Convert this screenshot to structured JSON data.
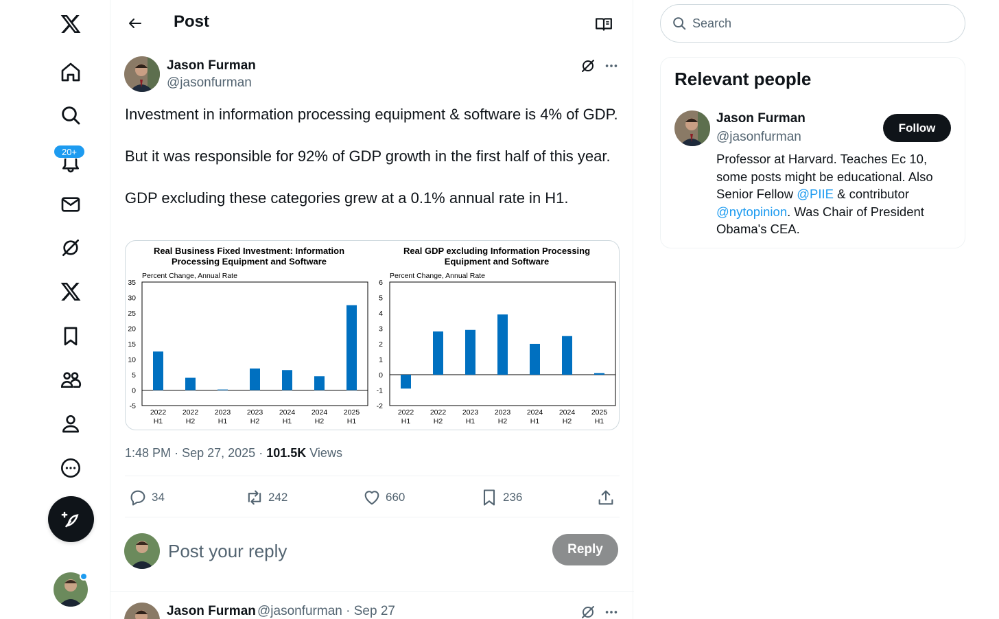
{
  "nav": {
    "notifications_badge": "20+"
  },
  "header": {
    "title": "Post"
  },
  "post": {
    "author_name": "Jason Furman",
    "author_handle": "@jasonfurman",
    "text": [
      "Investment in information processing equipment & software is 4% of GDP.",
      "But it was responsible for 92% of GDP growth in the first half of this year.",
      "GDP excluding these categories grew at a 0.1% annual rate in H1."
    ],
    "time": "1:48 PM",
    "date": "Sep 27, 2025",
    "views_count": "101.5K",
    "views_label": "Views",
    "stats": {
      "replies": "34",
      "reposts": "242",
      "likes": "660",
      "bookmarks": "236"
    }
  },
  "reply": {
    "placeholder": "Post your reply",
    "button_label": "Reply"
  },
  "thread": {
    "author_name": "Jason Furman",
    "meta": "@jasonfurman · Sep 27"
  },
  "search": {
    "placeholder": "Search"
  },
  "relevant_people": {
    "title": "Relevant people",
    "name": "Jason Furman",
    "handle": "@jasonfurman",
    "follow_label": "Follow",
    "bio_1": "Professor at Harvard. Teaches Ec 10, some posts might be educational. Also Senior Fellow ",
    "mention_1": "@PIIE",
    "bio_2": " & contributor ",
    "mention_2": "@nytopinion",
    "bio_3": ". Was Chair of President Obama's CEA."
  },
  "colors": {
    "accent": "#1d9bf0",
    "bar": "#0070c0",
    "text_primary": "#0f1419",
    "text_secondary": "#536471"
  },
  "chart_data": [
    {
      "type": "bar",
      "title": "Real Business Fixed Investment: Information Processing Equipment and Software",
      "ylabel": "Percent Change, Annual Rate",
      "categories": [
        "2022 H1",
        "2022 H2",
        "2023 H1",
        "2023 H2",
        "2024 H1",
        "2024 H2",
        "2025 H1"
      ],
      "cat_top": [
        "2022",
        "2022",
        "2023",
        "2023",
        "2024",
        "2024",
        "2025"
      ],
      "cat_bottom": [
        "H1",
        "H2",
        "H1",
        "H2",
        "H1",
        "H2",
        "H1"
      ],
      "values": [
        12.5,
        4,
        0.2,
        7,
        6.5,
        4.5,
        27.5
      ],
      "ylim": [
        -5,
        35
      ],
      "yticks": [
        -5,
        0,
        5,
        10,
        15,
        20,
        25,
        30,
        35
      ],
      "grid": false
    },
    {
      "type": "bar",
      "title": "Real GDP excluding Information Processing Equipment and Software",
      "ylabel": "Percent Change, Annual Rate",
      "categories": [
        "2022 H1",
        "2022 H2",
        "2023 H1",
        "2023 H2",
        "2024 H1",
        "2024 H2",
        "2025 H1"
      ],
      "cat_top": [
        "2022",
        "2022",
        "2023",
        "2023",
        "2024",
        "2024",
        "2025"
      ],
      "cat_bottom": [
        "H1",
        "H2",
        "H1",
        "H2",
        "H1",
        "H2",
        "H1"
      ],
      "values": [
        -0.9,
        2.8,
        2.9,
        3.9,
        2.0,
        2.5,
        0.1
      ],
      "ylim": [
        -2,
        6
      ],
      "yticks": [
        -2,
        -1,
        0,
        1,
        2,
        3,
        4,
        5,
        6
      ],
      "grid": false
    }
  ]
}
